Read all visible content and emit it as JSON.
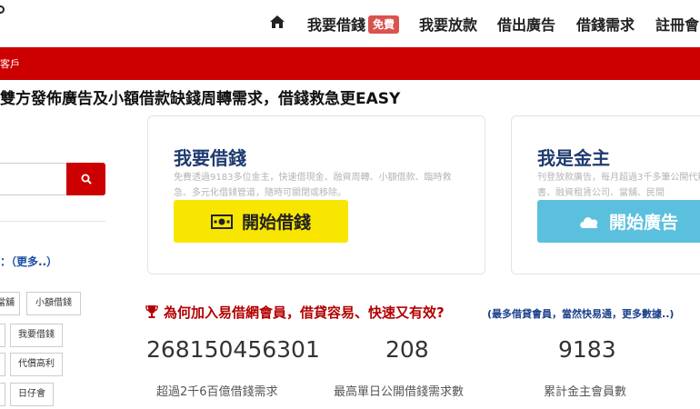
{
  "nav": {
    "items": [
      "我要借錢",
      "我要放款",
      "借出廣告",
      "借錢需求",
      "註冊會"
    ],
    "badge": "免費"
  },
  "banner": {
    "text": "客戶"
  },
  "headline": "雙方發佈廣告及小額借款缺錢周轉需求，借錢救急更EASY",
  "sidebar": {
    "category_title": "：（更多..）",
    "tags": [
      "當舖",
      "小額借錢",
      "",
      "我要借錢",
      "",
      "代償高利",
      "",
      "日仔會"
    ]
  },
  "cards": [
    {
      "title": "我要借錢",
      "desc": "免費透過9183多位金主，快速借現金、融資周轉、小額借款、臨時救急、多元化借錢管道，隨時可關閉或移除。",
      "button": "開始借錢"
    },
    {
      "title": "我是金主",
      "desc": "刊登放款廣告，每月超過3千多筆公開代辦代書、融資租賃公司、當舖、民間",
      "button": "開始廣告"
    }
  ],
  "why": {
    "title": "為何加入易借網會員，借貸容易、快速又有效?",
    "link": "(最多借貸會員，當然快易通，更多數據..)"
  },
  "stats": [
    {
      "value": "268150456301",
      "label": "超過2千6百億借錢需求"
    },
    {
      "value": "208",
      "label": "最高單日公開借錢需求數"
    },
    {
      "value": "9183",
      "label": "累計金主會員數"
    }
  ]
}
